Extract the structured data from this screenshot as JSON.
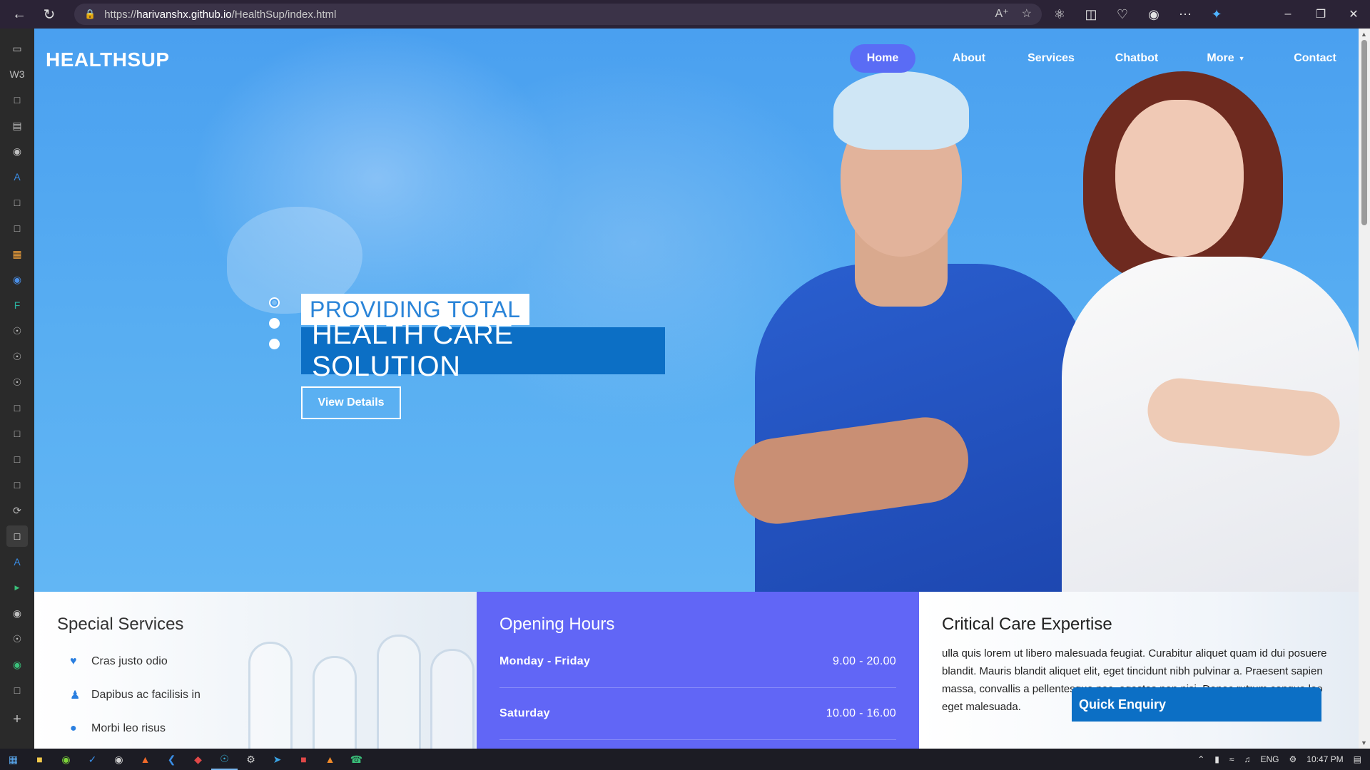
{
  "browser": {
    "url_prefix": "https://",
    "url_host": "harivanshx.github.io",
    "url_path": "/HealthSup/index.html",
    "icons": [
      "back-icon",
      "refresh-icon",
      "lock-icon",
      "read-aloud-icon",
      "favorite-icon",
      "extensions-icon",
      "split-screen-icon",
      "collections-icon",
      "profile-icon",
      "more-icon",
      "copilot-icon"
    ]
  },
  "site": {
    "brand": "HEALTHSUP",
    "nav": {
      "home": "Home",
      "about": "About",
      "services": "Services",
      "chatbot": "Chatbot",
      "more": "More",
      "contact": "Contact"
    },
    "hero": {
      "caption_line1": "PROVIDING TOTAL",
      "caption_line2": "HEALTH CARE SOLUTION",
      "button": "View Details",
      "slides": 3,
      "active_slide": 1
    },
    "special_services": {
      "title": "Special Services",
      "items": [
        {
          "label": "Cras justo odio",
          "icon": "heartbeat-icon"
        },
        {
          "label": "Dapibus ac facilisis in",
          "icon": "user-md-icon"
        },
        {
          "label": "Morbi leo risus",
          "icon": "pills-icon"
        }
      ]
    },
    "opening_hours": {
      "title": "Opening Hours",
      "rows": [
        {
          "day": "Monday - Friday",
          "time": "9.00 - 20.00"
        },
        {
          "day": "Saturday",
          "time": "10.00 - 16.00"
        }
      ]
    },
    "critical_care": {
      "title": "Critical Care Expertise",
      "text": "ulla quis lorem ut libero malesuada feugiat. Curabitur aliquet quam id dui posuere blandit. Mauris blandit aliquet elit, eget tincidunt nibh pulvinar a. Praesent sapien massa, convallis a pellentesque nec, egestas non nisi. Donec rutrum congue leo eget malesuada."
    },
    "quick_enquiry": "Quick Enquiry"
  },
  "taskbar": {
    "tray": {
      "lang": "ENG",
      "time": "10:47 PM"
    }
  },
  "colors": {
    "hero_blue": "#4aa0f0",
    "nav_active": "#5a6cf5",
    "caption_blue": "#0c6fc5",
    "hours_panel": "#6166f6"
  }
}
